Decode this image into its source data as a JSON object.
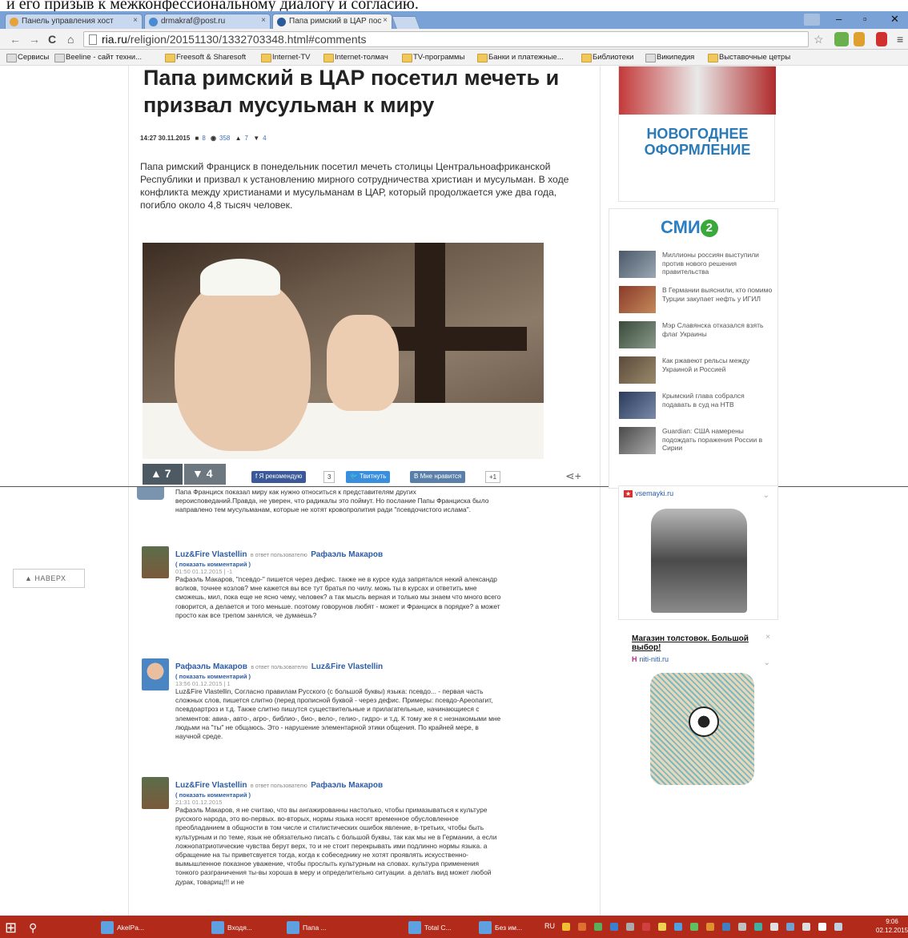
{
  "caption": "и его призыв к межконфессиональному диалогу и согласию.",
  "browser": {
    "tabs": [
      {
        "label": "Панель управления хост",
        "active": false
      },
      {
        "label": "drmakraf@post.ru",
        "active": false
      },
      {
        "label": "Папа римский в ЦАР пос",
        "active": true
      }
    ],
    "url_host": "ria.ru",
    "url_path": "/religion/20151130/1332703348.html#comments",
    "bookmarks": [
      "Сервисы",
      "Beeline - сайт техни...",
      "Freesoft & Sharesoft",
      "Internet-TV",
      "Internet-толмач",
      "TV-программы",
      "Банки и платежные...",
      "Библиотеки",
      "Википедия",
      "Выставочные цетры"
    ]
  },
  "article": {
    "title": "Папа римский в ЦАР посетил мечеть и призвал мусульман к миру",
    "meta": {
      "time": "14:27 30.11.2015",
      "comments": "8",
      "views": "358",
      "likes": "7",
      "dislikes": "4"
    },
    "lead": "Папа римский Франциск в понедельник посетил мечеть столицы Центральноафриканской Республики и призвал к установлению мирного сотрудничества христиан и мусульман. В ходе конфликта между христианами и мусульманам в ЦАР, который продолжается уже два года, погибло около 4,8 тысяч человек.",
    "likes": "7",
    "dislikes": "4",
    "share": {
      "recommend": "Я рекомендую",
      "recommend_count": "3",
      "tweet": "Твитнуть",
      "vk": "Мне нравится",
      "vk_count": "+1"
    }
  },
  "back_to_top": "НАВЕРХ",
  "comments": {
    "first_fragment": "Папа Франциск показал миру как нужно относиться к представителям других вероисповеданий.Правда, не уверен, что радикалы это поймут. Но послание Папы Франциска было направлено тем мусульманам, которые не хотят кровопролития ради \"псевдочистого ислама\".",
    "items": [
      {
        "author": "Luz&Fire Vlastellin",
        "reply_to_label": "в ответ пользователю",
        "reply_to": "Рафаэль Макаров",
        "show": "( показать комментарий )",
        "date": "01:50 01.12.2015 | -1",
        "text": "Рафаэль Макаров, \"псевдо-\" пишется через дефис. также не в курсе куда запрятался некий александр волков, точнее козлов? мне кажется вы все тут братья по чилу. можь ты в курсах и ответить мне сможешь, мил, пока еще не ясно чему, человек? а так мысль верная и только мы знаем что много всего говорится, а делается и того меньше. поэтому говорунов любят - может и Франциск в порядке? а может просто как все трепом занялся, че думаешь?"
      },
      {
        "author": "Рафаэль Макаров",
        "reply_to_label": "в ответ пользователю",
        "reply_to": "Luz&Fire Vlastellin",
        "show": "( показать комментарий )",
        "date": "13:56 01.12.2015 | 1",
        "text": "Luz&Fire Vlastellin, Согласно правилам Русского (с большой буквы) языка: псевдо... - первая часть сложных слов, пишется слитно (перед прописной буквой - через дефис. Примеры: псевдо-Ареопагит, псевдоартроз и т.д. Также слитно пишутся существительные и прилагательные, начинающиеся с элементов: авиа-, авто-, агро-, библио-, био-, вело-, гелио-, гидро- и т.д. К тому же я с незнакомыми мне людьми на \"ты\" не общаюсь. Это - нарушение элементарной этики общения. По крайней мере, в научной среде."
      },
      {
        "author": "Luz&Fire Vlastellin",
        "reply_to_label": "в ответ пользователю",
        "reply_to": "Рафаэль Макаров",
        "show": "( показать комментарий )",
        "date": "21:31 01.12.2015",
        "text": "Рафаэль Макаров, я не считаю, что вы ангажированны настолько, чтобы примазываться к культуре русского народа, это во-первых. во-вторых, нормы языка носят временное обусловленное преобладанием в общности в том числе и стилистических ошибок явление, в-третьих, чтобы быть культурным и по теме, язык не обязательно писать с большой буквы, так как мы не в Германии, а если ложнопатриотические чувства берут верх, то и не стоит перекрывать ими подлинно нормы языка. а обращение на ты приветсвуется тогда, когда к собеседнику не хотят проявлять искусственно-вымышленное показное уважение, чтобы прослыть культурным на словах. культура применения тонкого разграничения ты-вы хороша в меру и определительно ситуации. а делать вид может любой дурак, товарищ!!! и не"
      }
    ]
  },
  "sidebar": {
    "ad1_text": "НОВОГОДНЕЕ ОФОРМЛЕНИЕ",
    "smi_logo": "СМИ",
    "smi_logo_num": "2",
    "smi_items": [
      "Миллионы россиян выступили против нового решения правительства",
      "В Германии выяснили, кто помимо Турции закупает нефть у ИГИЛ",
      "Мэр Славянска отказался взять флаг Украины",
      "Как ржавеют рельсы между Украиной и Россией",
      "Крымский глава собрался подавать в суд на НТВ",
      "Guardian: США намерены подождать поражения России в Сирии"
    ],
    "ad2_source": "vsemayki.ru",
    "ad3_title": "Магазин толстовок. Большой выбор!",
    "ad3_source": "niti-niti.ru"
  },
  "taskbar": {
    "items": [
      "AkelPa...",
      "Входя...",
      "Папа ...",
      "Total C...",
      "Без им..."
    ],
    "lang": "RU",
    "time": "9:06",
    "date": "02.12.2015"
  }
}
